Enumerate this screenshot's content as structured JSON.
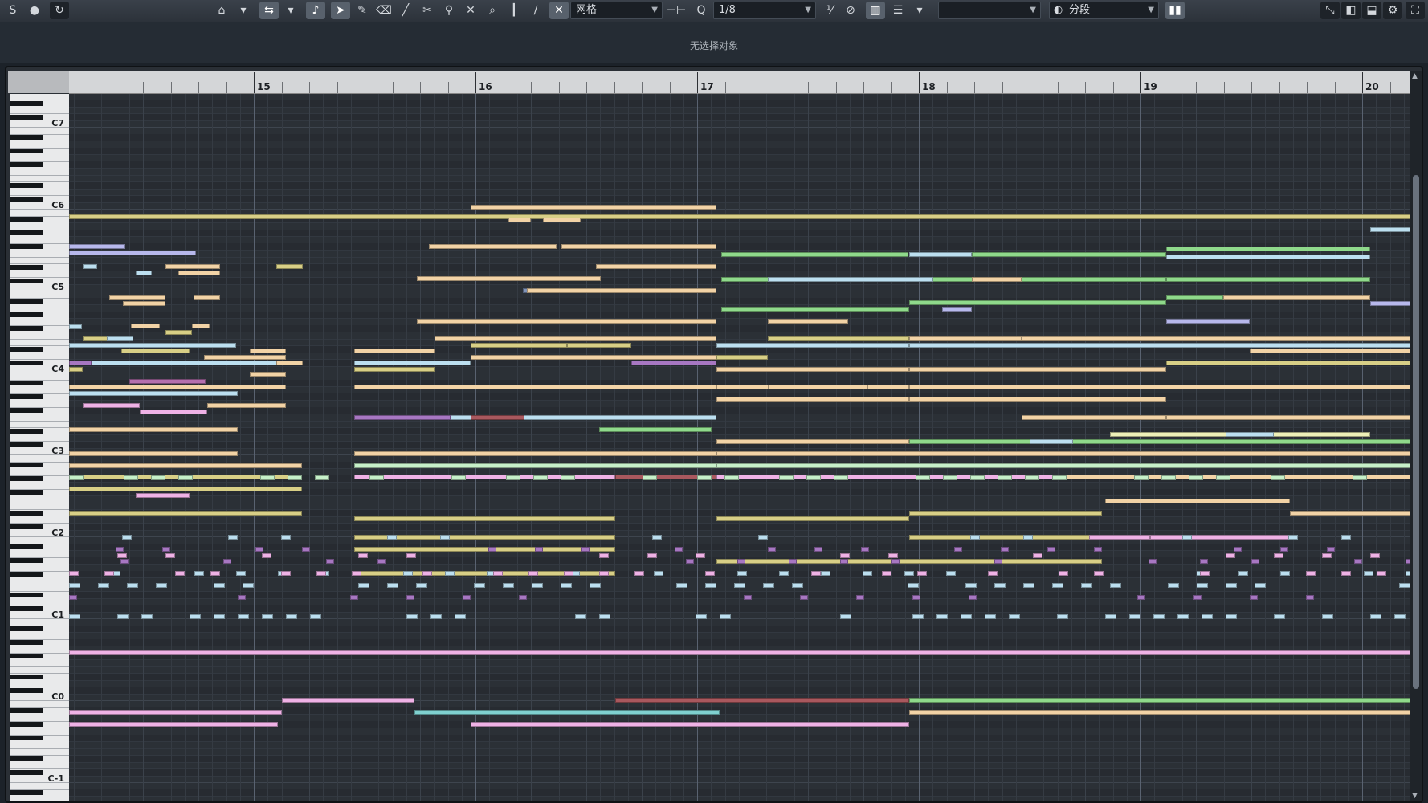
{
  "toolbar": {
    "buttons": [
      {
        "name": "solo-icon",
        "glyph": "S"
      },
      {
        "name": "record-icon",
        "glyph": "●"
      },
      {
        "name": "feedback-icon",
        "glyph": "↻"
      },
      {
        "name": "autoscroll-icon",
        "glyph": "⌂"
      },
      {
        "name": "autoscroll-menu-icon",
        "glyph": "▾"
      },
      {
        "name": "step-input-icon",
        "glyph": "⇆"
      },
      {
        "name": "step-menu-icon",
        "glyph": "▾"
      },
      {
        "name": "acoustic-feedback-icon",
        "glyph": "♪"
      },
      {
        "name": "select-tool-icon",
        "glyph": "➤"
      },
      {
        "name": "draw-tool-icon",
        "glyph": "✎"
      },
      {
        "name": "erase-tool-icon",
        "glyph": "⌫"
      },
      {
        "name": "line-tool-icon",
        "glyph": "╱"
      },
      {
        "name": "split-tool-icon",
        "glyph": "✂"
      },
      {
        "name": "glue-tool-icon",
        "glyph": "⚲"
      },
      {
        "name": "mute-tool-icon",
        "glyph": "✕"
      },
      {
        "name": "zoom-tool-icon",
        "glyph": "⌕"
      },
      {
        "name": "trim-tool-icon",
        "glyph": "┃"
      },
      {
        "name": "timewarp-tool-icon",
        "glyph": "∕"
      }
    ],
    "snap_icon": "snap-icon",
    "snap_type": "网格",
    "grid_icon": "grid-quantize-icon",
    "quantize_value": "1/8",
    "swing_icon": "swing-icon",
    "length_icon": "length-icon",
    "color_scheme": "",
    "chord_mode": "分段",
    "right_icons": [
      "expand-icon",
      "layout-left-icon",
      "layout-bottom-icon",
      "settings-icon",
      "maximize-icon"
    ]
  },
  "info": {
    "status": "无选择对象"
  },
  "ruler": {
    "bars": [
      "15",
      "16",
      "17",
      "18",
      "19",
      "20"
    ]
  },
  "keyboard": {
    "octaves": [
      "C7",
      "C6",
      "C5",
      "C4",
      "C3",
      "C2",
      "C1",
      "C0",
      "C-1"
    ]
  },
  "colors": {
    "cream": "#f2d3a6",
    "yellow": "#d8cf86",
    "lightblue": "#bcdff0",
    "lavender": "#b7b8ec",
    "pink": "#efb2e6",
    "green": "#8fd98b",
    "purple": "#a777c2",
    "mauve": "#b46fae",
    "darkred": "#a9585e",
    "teal": "#7fd0cf",
    "steel": "#7f93b8",
    "paleyellow": "#eef0b8",
    "mint": "#c6f0c9"
  }
}
